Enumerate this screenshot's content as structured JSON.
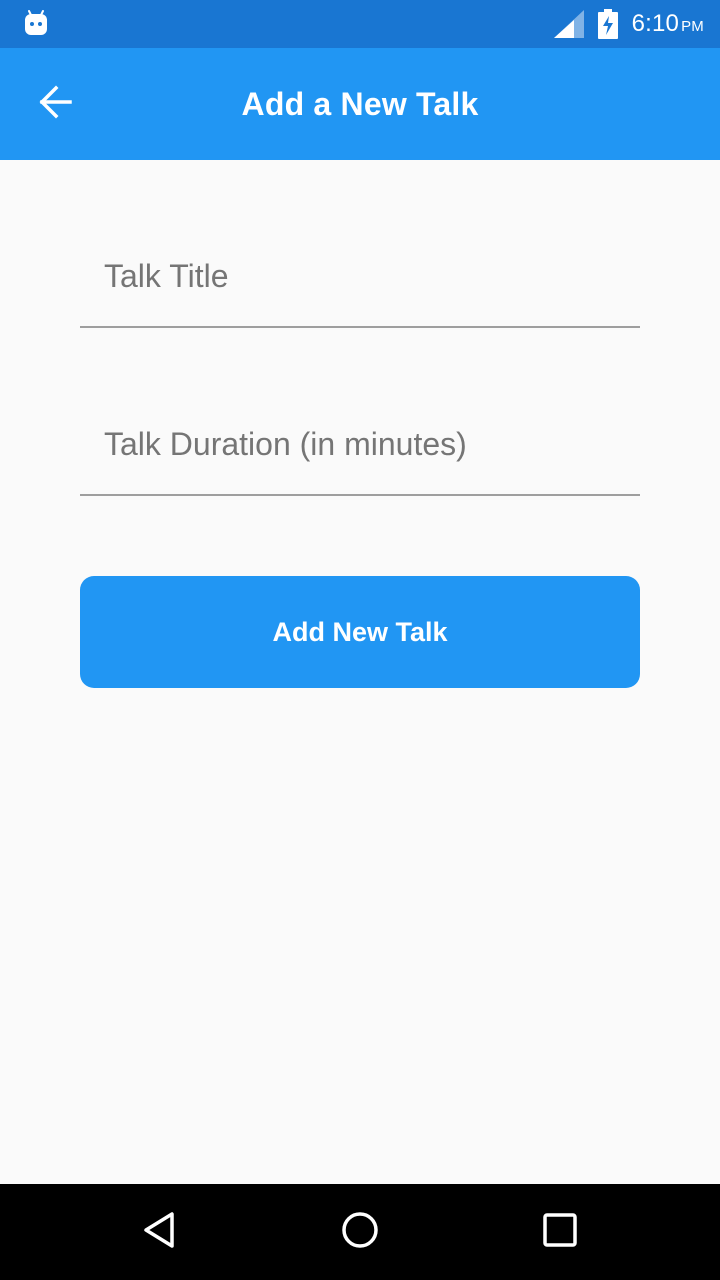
{
  "status_bar": {
    "time": "6:10",
    "ampm": "PM",
    "icons": [
      "android-debug-icon",
      "cell-signal-icon",
      "battery-charging-icon"
    ]
  },
  "app_bar": {
    "title": "Add a New Talk",
    "back_icon": "arrow-back-icon",
    "color": "#2196f3"
  },
  "form": {
    "title_field": {
      "placeholder": "Talk Title",
      "value": ""
    },
    "duration_field": {
      "placeholder": "Talk Duration (in minutes)",
      "value": ""
    },
    "submit_label": "Add New Talk"
  },
  "nav_bar": {
    "icons": [
      "nav-back-icon",
      "nav-home-icon",
      "nav-recent-icon"
    ]
  },
  "colors": {
    "accent": "#2196f3",
    "status_bar": "#1976d2",
    "background": "#fafafa"
  }
}
